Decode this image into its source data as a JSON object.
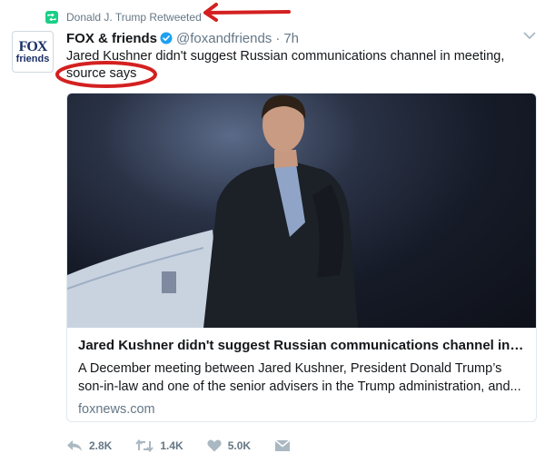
{
  "retweet": {
    "label": "Donald J. Trump Retweeted",
    "icon": "retweet-icon",
    "color": "#19cf86"
  },
  "tweet": {
    "author": {
      "name": "FOX & friends",
      "handle": "@foxandfriends",
      "verified": true,
      "avatar_text_top": "FOX",
      "avatar_text_bottom": "friends"
    },
    "separator": "·",
    "time": "7h",
    "text_line1": "Jared Kushner didn't suggest Russian communications channel in meeting,",
    "text_line2": "source says"
  },
  "card": {
    "title": "Jared Kushner didn't suggest Russian communications channel in m...",
    "description": "A December meeting between Jared Kushner, President Donald Trump’s son-in-law and one of the senior advisers in the Trump administration, and...",
    "domain": "foxnews.com",
    "image_alt": "Photo of Jared Kushner in a dark suit beside an aircraft"
  },
  "actions": {
    "reply_count": "2.8K",
    "retweet_count": "1.4K",
    "like_count": "5.0K"
  },
  "colors": {
    "annotation": "#d42020",
    "secondary_text": "#657786",
    "verified": "#1da1f2"
  }
}
